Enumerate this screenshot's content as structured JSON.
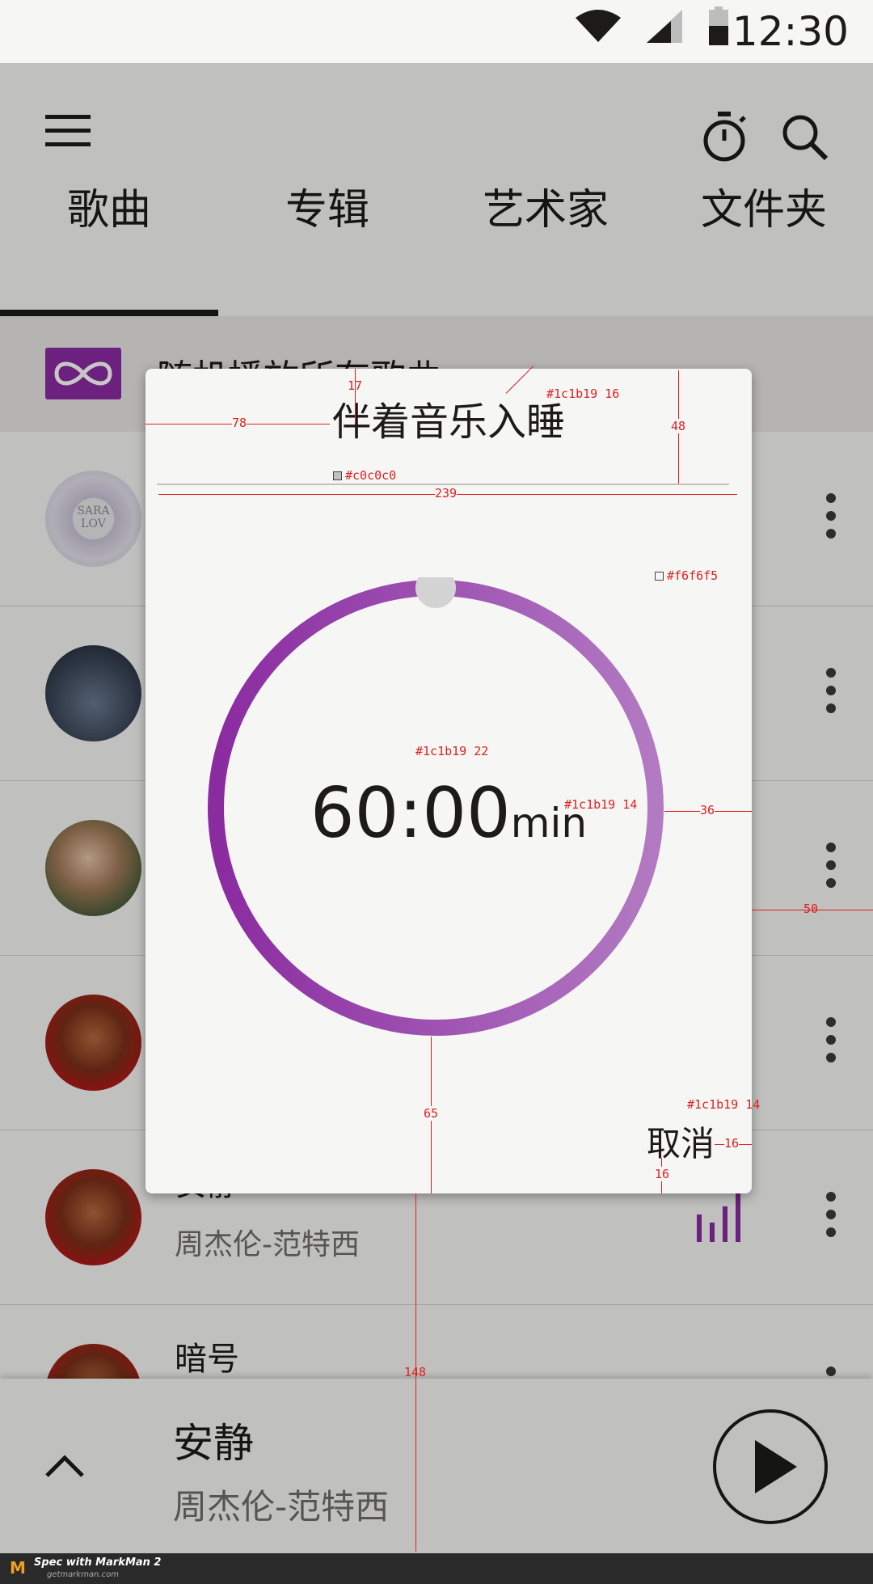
{
  "status_bar": {
    "time": "12:30",
    "icons": [
      "wifi-icon",
      "signal-icon",
      "battery-icon"
    ]
  },
  "app_bar": {
    "icons": [
      "menu-icon",
      "timer-icon",
      "search-icon"
    ]
  },
  "tabs": [
    {
      "label": "歌曲",
      "active": true
    },
    {
      "label": "专辑",
      "active": false
    },
    {
      "label": "艺术家",
      "active": false
    },
    {
      "label": "文件夹",
      "active": false
    }
  ],
  "shuffle": {
    "label": "随机播放所有歌曲"
  },
  "songs": [
    {
      "title": "安静",
      "subtitle": "周杰伦-范特西",
      "playing": true
    },
    {
      "title": "暗号",
      "subtitle": ""
    }
  ],
  "now_playing": {
    "title": "安静",
    "subtitle": "周杰伦-范特西"
  },
  "dialog": {
    "title": "伴着音乐入睡",
    "time": "60:00",
    "unit": "min",
    "cancel": "取消",
    "progress": 1.0
  },
  "colors": {
    "accent": "#8a2ba0",
    "text": "#1c1b19",
    "background": "#f6f6f5",
    "divider": "#c0c0c0",
    "knob": "#d3d3d3"
  },
  "annotations": {
    "title_color": "#1c1b19 16",
    "divider_color": "#c0c0c0",
    "bg_color": "#f6f6f5",
    "time_color": "#1c1b19 22",
    "unit_color": "#1c1b19 14",
    "cancel_color": "#1c1b19 14",
    "d17": "17",
    "d78": "78",
    "d48": "48",
    "d239": "239",
    "d36": "36",
    "d50": "50",
    "d65": "65",
    "d16a": "16",
    "d16b": "16",
    "d148": "148"
  },
  "footer": {
    "label": "Spec with MarkMan 2",
    "site": "getmarkman.com"
  }
}
